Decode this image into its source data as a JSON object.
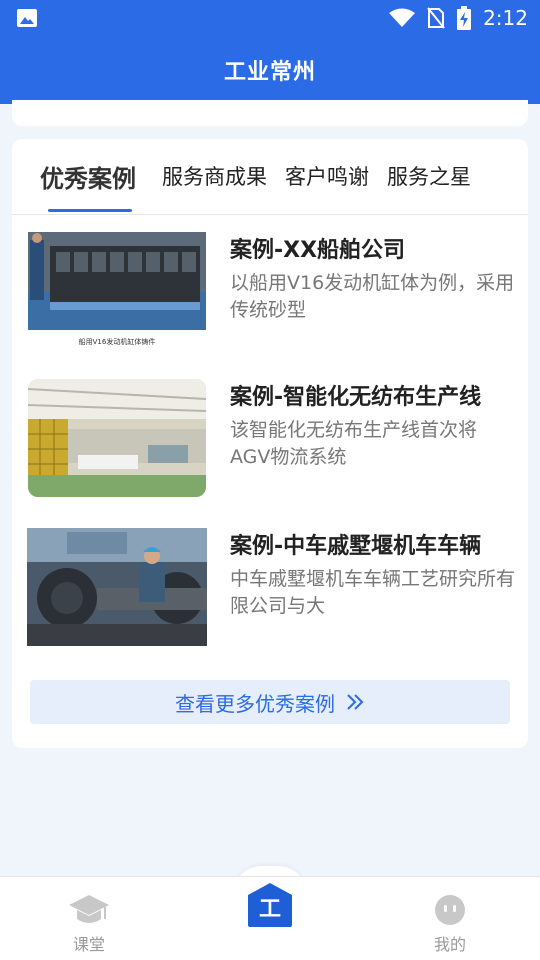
{
  "status": {
    "time": "2:12",
    "icons": [
      "image-icon",
      "wifi-icon",
      "no-sim-icon",
      "battery-charging-icon"
    ]
  },
  "header": {
    "title": "工业常州"
  },
  "tabs": [
    {
      "label": "优秀案例",
      "active": true
    },
    {
      "label": "服务商成果",
      "active": false
    },
    {
      "label": "客户鸣谢",
      "active": false
    },
    {
      "label": "服务之星",
      "active": false
    }
  ],
  "cases": [
    {
      "title": "案例-XX船舶公司",
      "desc": "以船用V16发动机缸体为例，采用传统砂型",
      "image_caption": "船用V16发动机缸体铸件"
    },
    {
      "title": "案例-智能化无纺布生产线",
      "desc": "该智能化无纺布生产线首次将AGV物流系统"
    },
    {
      "title": "案例-中车戚墅堰机车车辆",
      "desc": "中车戚墅堰机车车辆工艺研究所有限公司与大"
    }
  ],
  "more": {
    "label": "查看更多优秀案例"
  },
  "bottom_nav": {
    "left_label": "课堂",
    "center_glyph": "工",
    "right_label": "我的"
  },
  "colors": {
    "primary": "#2b6be6",
    "background": "#f0f4fb"
  }
}
